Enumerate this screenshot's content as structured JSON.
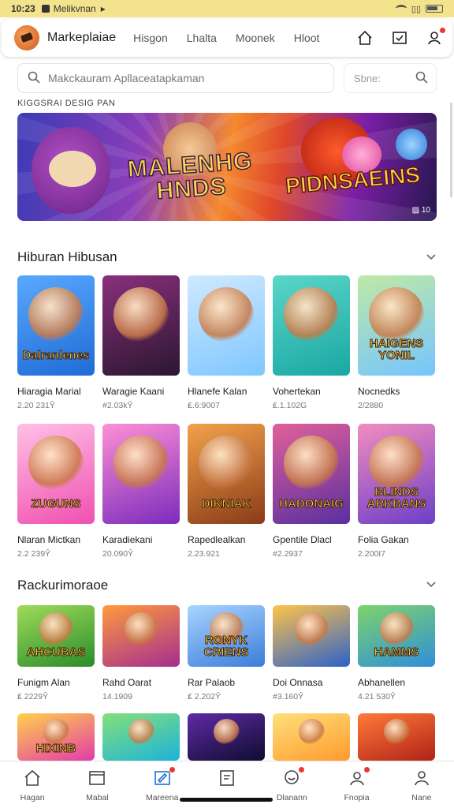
{
  "status_bar": {
    "time": "10:23",
    "app_name": "Melikvnan"
  },
  "header": {
    "brand": "Markeplaiae",
    "nav": [
      "Hisgon",
      "Lhalta",
      "Moonek",
      "Hloot"
    ],
    "icons": [
      "home-icon",
      "inbox-icon",
      "user-icon"
    ]
  },
  "search": {
    "placeholder": "Makckauram Apllaceatapkaman",
    "secondary_placeholder": "Sbne:"
  },
  "banner": {
    "caption": "KIGGSRAI DESIG PAN",
    "title_left": "MALENHG HNDS",
    "title_right": "PIDNSAEINS",
    "corner": "▨ 10"
  },
  "sections": [
    {
      "title": "Hiburan Hibusan",
      "items": [
        {
          "name": "Hiaragia Marial",
          "meta": "2.20 231Ŷ",
          "thumb_text": "Dalranlenes",
          "colors": [
            "#1f6bd6",
            "#59a8ff"
          ]
        },
        {
          "name": "Waragie Kaani",
          "meta": "#2.03kŶ",
          "thumb_text": "",
          "colors": [
            "#2a1730",
            "#8a2f7d"
          ]
        },
        {
          "name": "Hlanefe Kalan",
          "meta": "₤.6:9007",
          "thumb_text": "",
          "colors": [
            "#7fc7ff",
            "#cfe9ff"
          ]
        },
        {
          "name": "Vohertekan",
          "meta": "₤.1.102G",
          "thumb_text": "",
          "colors": [
            "#1aa7a3",
            "#5ad6c9"
          ]
        },
        {
          "name": "Nocnedks",
          "meta": "2/2880",
          "thumb_text": "HAIGENS YONIL",
          "colors": [
            "#74c5ff",
            "#bfe9a6"
          ]
        }
      ]
    },
    {
      "title": "",
      "items": [
        {
          "name": "Nlaran Mictkan",
          "meta": "2.2 239Ŷ",
          "thumb_text": "ZUGUNS",
          "colors": [
            "#f04fb0",
            "#ffc0e6"
          ]
        },
        {
          "name": "Karadiekani",
          "meta": "20.090Ŷ",
          "thumb_text": "",
          "colors": [
            "#7c2bbd",
            "#ff8fd5"
          ]
        },
        {
          "name": "Rapedlealkan",
          "meta": "2.23.921",
          "thumb_text": "DIKNIAK",
          "colors": [
            "#8a3b18",
            "#f2a24a"
          ]
        },
        {
          "name": "Gpentile Dlacl",
          "meta": "#2.2937",
          "thumb_text": "HADONAIG",
          "colors": [
            "#5a2fa0",
            "#e0609a"
          ]
        },
        {
          "name": "Folia Gakan",
          "meta": "2.200I7",
          "thumb_text": "BLINDS ARKBANS",
          "colors": [
            "#6d3fc8",
            "#f28cbf"
          ]
        }
      ]
    },
    {
      "title": "Rackurimoraoe",
      "items": [
        {
          "name": "Funigm Alan",
          "meta": "₤ 2229Ŷ",
          "thumb_text": "AHCUBAS",
          "colors": [
            "#2a8c2a",
            "#9edb5a"
          ]
        },
        {
          "name": "Rahd Oarat",
          "meta": "14.1909",
          "thumb_text": "",
          "colors": [
            "#a52d8f",
            "#ff9a3d"
          ]
        },
        {
          "name": "Rar Palaob",
          "meta": "₤ 2.202Ŷ",
          "thumb_text": "RONYK CRIENS",
          "colors": [
            "#3c7dd9",
            "#a8d4ff"
          ]
        },
        {
          "name": "Doi Onnasa",
          "meta": "#3.160Ŷ",
          "thumb_text": "",
          "colors": [
            "#2c62c9",
            "#ffc34a"
          ]
        },
        {
          "name": "Abhanellen",
          "meta": "4.21 530Ŷ",
          "thumb_text": "HAMMS",
          "colors": [
            "#2e8fd9",
            "#7ed36b"
          ]
        }
      ]
    },
    {
      "title": "",
      "items": [
        {
          "name": "",
          "meta": "",
          "thumb_text": "HIXINB",
          "colors": [
            "#e33ba9",
            "#ffd24a"
          ]
        },
        {
          "name": "",
          "meta": "",
          "thumb_text": "",
          "colors": [
            "#1cb3d9",
            "#86e07a"
          ]
        },
        {
          "name": "",
          "meta": "",
          "thumb_text": "",
          "colors": [
            "#0f0c2e",
            "#5f2aa8"
          ]
        },
        {
          "name": "",
          "meta": "",
          "thumb_text": "",
          "colors": [
            "#ff9a2e",
            "#ffe07a"
          ]
        },
        {
          "name": "",
          "meta": "",
          "thumb_text": "",
          "colors": [
            "#b02217",
            "#ff7a3a"
          ]
        }
      ]
    }
  ],
  "bottom_nav": [
    {
      "label": "Hagan",
      "icon": "home-icon",
      "badge": false
    },
    {
      "label": "Mabal",
      "icon": "inbox-icon",
      "badge": false
    },
    {
      "label": "Mareena",
      "icon": "edit-icon",
      "badge": true
    },
    {
      "label": "",
      "icon": "document-icon",
      "badge": false
    },
    {
      "label": "Dlanann",
      "icon": "chat-icon",
      "badge": true
    },
    {
      "label": "Fnopia",
      "icon": "bell-icon",
      "badge": true
    },
    {
      "label": "Nane",
      "icon": "profile-icon",
      "badge": false
    }
  ],
  "colors": {
    "status_bar": "#f3e38c",
    "badge": "#e53935",
    "active_nav": "#1f6fd6"
  }
}
